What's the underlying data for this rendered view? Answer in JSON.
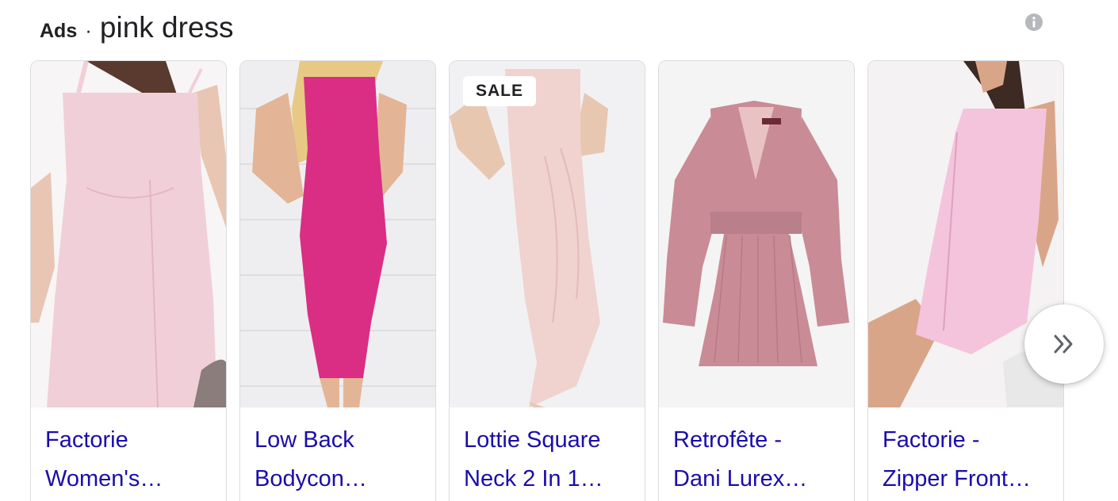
{
  "header": {
    "ads_label": "Ads",
    "separator": "·",
    "query": "pink dress"
  },
  "icons": {
    "info": "info-icon",
    "next": "chevron-double-right-icon"
  },
  "products": [
    {
      "title_line1": "Factorie",
      "title_line2": "Women's…",
      "dress_color": "#f1cfd9",
      "background": "#f7f5f5"
    },
    {
      "title_line1": "Low Back",
      "title_line2": "Bodycon…",
      "dress_color": "#d92e84",
      "background": "#eeeef0"
    },
    {
      "title_line1": "Lottie Square",
      "title_line2": "Neck 2 In 1…",
      "dress_color": "#f0d2cf",
      "background": "#f1f1f3",
      "badge": "SALE"
    },
    {
      "title_line1": "Retrofête -",
      "title_line2": "Dani Lurex…",
      "dress_color": "#c98b96",
      "background": "#f4f4f4"
    },
    {
      "title_line1": "Factorie -",
      "title_line2": "Zipper Front…",
      "dress_color": "#f4c4dc",
      "background": "#f4f2f2"
    }
  ],
  "colors": {
    "link": "#1a0dab",
    "text": "#202124",
    "border": "#dadce0"
  }
}
